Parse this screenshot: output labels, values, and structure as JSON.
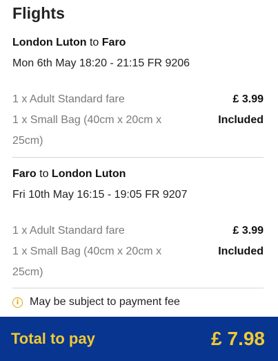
{
  "title": "Flights",
  "legs": [
    {
      "from": "London Luton",
      "connector": "to",
      "to": "Faro",
      "schedule": "Mon 6th May 18:20 - 21:15 FR 9206",
      "items": [
        {
          "description": "1 x Adult Standard fare",
          "price": "£ 3.99"
        },
        {
          "description": "1 x Small Bag (40cm x 20cm x 25cm)",
          "price": "Included"
        }
      ]
    },
    {
      "from": "Faro",
      "connector": "to",
      "to": "London Luton",
      "schedule": "Fri 10th May 16:15 - 19:05 FR 9207",
      "items": [
        {
          "description": "1 x Adult Standard fare",
          "price": "£ 3.99"
        },
        {
          "description": "1 x Small Bag (40cm x 20cm x 25cm)",
          "price": "Included"
        }
      ]
    }
  ],
  "notice": {
    "icon": "info-icon",
    "text": "May be subject to payment fee"
  },
  "total": {
    "label": "Total to pay",
    "amount": "£ 7.98"
  },
  "colors": {
    "total_bar_bg": "#073590",
    "total_text": "#f1c933",
    "info_icon": "#d9a400",
    "muted_text": "#7a7a7a"
  }
}
